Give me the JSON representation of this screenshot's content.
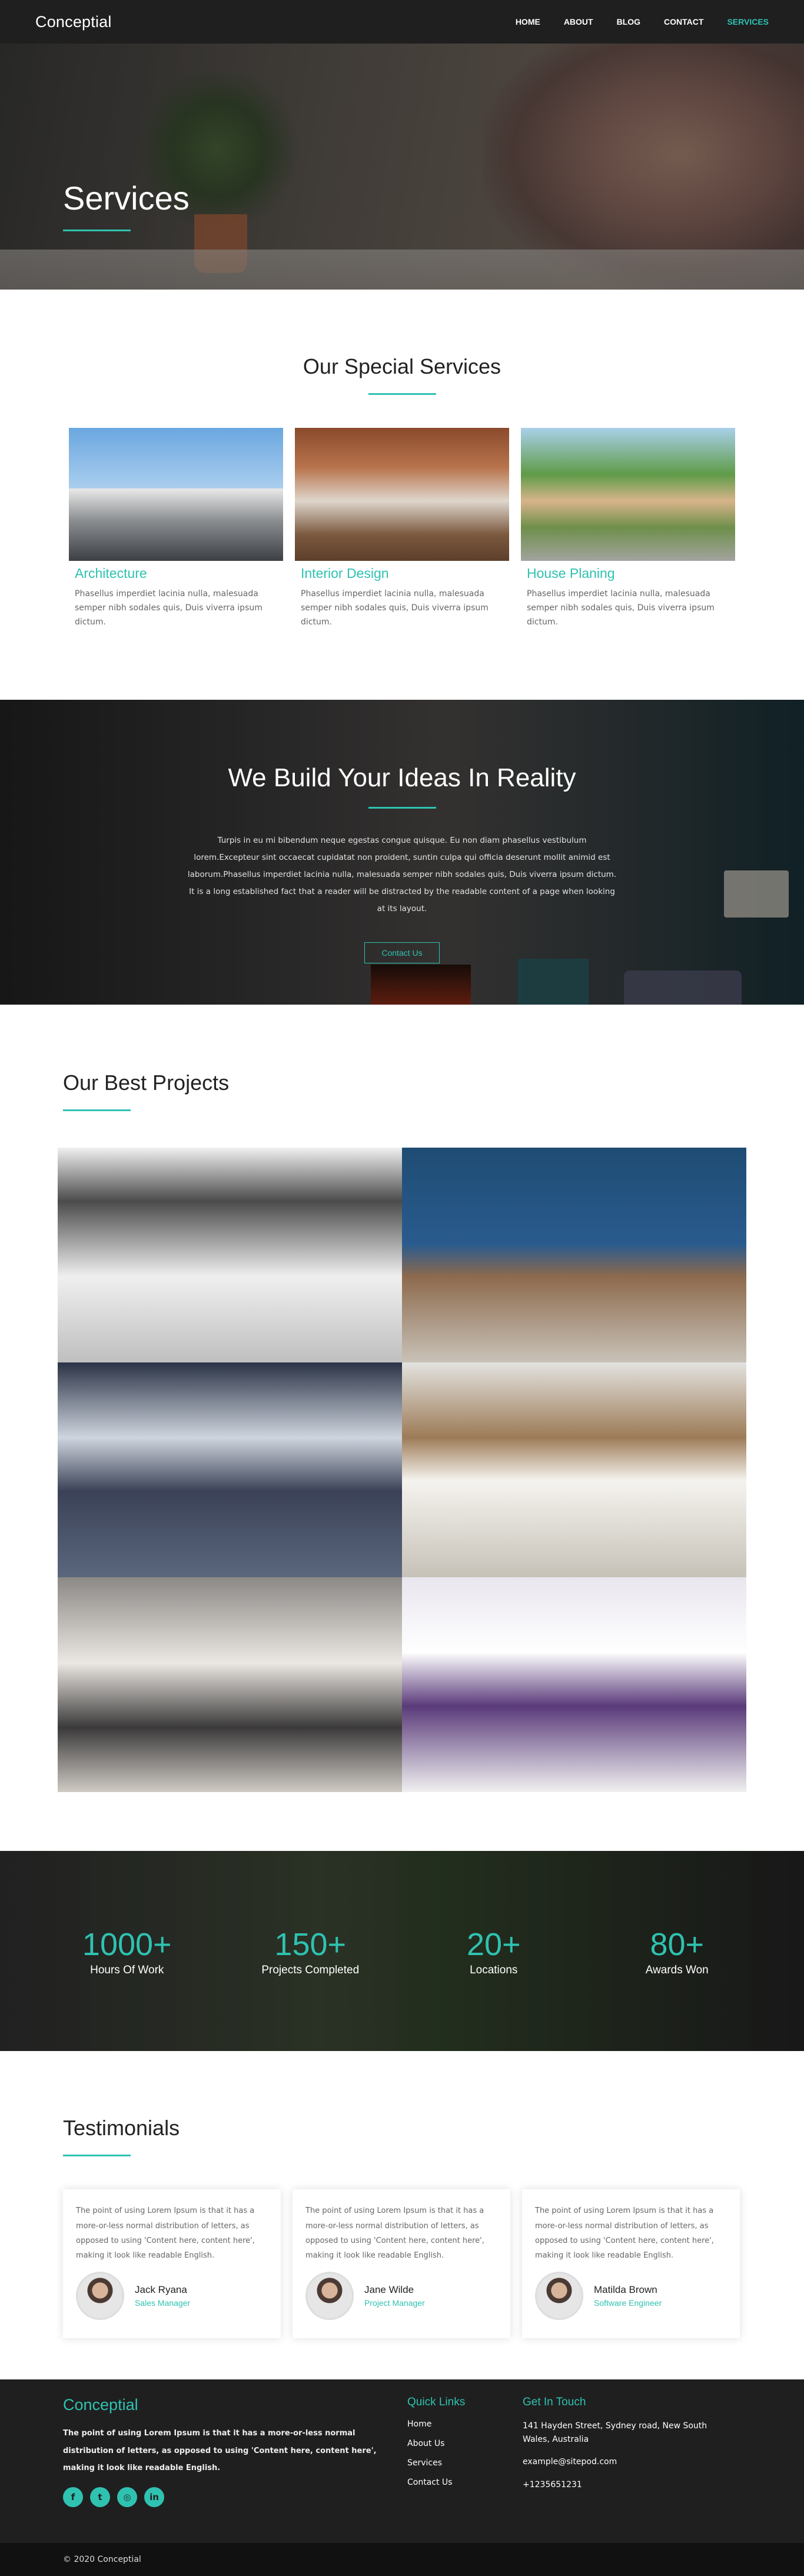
{
  "nav": {
    "logo": "Conceptial",
    "items": [
      {
        "label": "HOME",
        "active": false
      },
      {
        "label": "ABOUT",
        "active": false
      },
      {
        "label": "BLOG",
        "active": false
      },
      {
        "label": "CONTACT",
        "active": false
      },
      {
        "label": "SERVICES",
        "active": true
      }
    ]
  },
  "hero": {
    "title": "Services"
  },
  "services": {
    "title": "Our Special Services",
    "items": [
      {
        "title": "Architecture",
        "text": "Phasellus imperdiet lacinia nulla, malesuada semper nibh sodales quis, Duis viverra ipsum dictum."
      },
      {
        "title": "Interior Design",
        "text": "Phasellus imperdiet lacinia nulla, malesuada semper nibh sodales quis, Duis viverra ipsum dictum."
      },
      {
        "title": "House Planing",
        "text": "Phasellus imperdiet lacinia nulla, malesuada semper nibh sodales quis, Duis viverra ipsum dictum."
      }
    ]
  },
  "build": {
    "title": "We Build Your Ideas In Reality",
    "text": "Turpis in eu mi bibendum neque egestas congue quisque. Eu non diam phasellus vestibulum lorem.Excepteur sint occaecat cupidatat non proident, suntin culpa qui officia deserunt mollit animid est laborum.Phasellus imperdiet lacinia nulla, malesuada semper nibh sodales quis, Duis viverra ipsum dictum. It is a long established fact that a reader will be distracted by the readable content of a page when looking at its layout.",
    "button": "Contact Us"
  },
  "projects": {
    "title": "Our Best Projects"
  },
  "stats": [
    {
      "num": "1000+",
      "label": "Hours Of Work"
    },
    {
      "num": "150+",
      "label": "Projects Completed"
    },
    {
      "num": "20+",
      "label": "Locations"
    },
    {
      "num": "80+",
      "label": "Awards Won"
    }
  ],
  "testimonials": {
    "title": "Testimonials",
    "items": [
      {
        "text": "The point of using Lorem Ipsum is that it has a more-or-less normal distribution of letters, as opposed to using 'Content here, content here', making it look like readable English.",
        "name": "Jack Ryana",
        "role": "Sales Manager"
      },
      {
        "text": "The point of using Lorem Ipsum is that it has a more-or-less normal distribution of letters, as opposed to using 'Content here, content here', making it look like readable English.",
        "name": "Jane Wilde",
        "role": "Project Manager"
      },
      {
        "text": "The point of using Lorem Ipsum is that it has a more-or-less normal distribution of letters, as opposed to using 'Content here, content here', making it look like readable English.",
        "name": "Matilda Brown",
        "role": "Software Engineer"
      }
    ]
  },
  "footer": {
    "logo": "Conceptial",
    "about": "The point of using Lorem Ipsum is that it has a more-or-less normal distribution of letters, as opposed to using 'Content here, content here', making it look like readable English.",
    "socials": [
      {
        "icon": "facebook-icon",
        "glyph": "f"
      },
      {
        "icon": "twitter-icon",
        "glyph": "t"
      },
      {
        "icon": "instagram-icon",
        "glyph": "◎"
      },
      {
        "icon": "linkedin-icon",
        "glyph": "in"
      }
    ],
    "links_title": "Quick Links",
    "links": [
      "Home",
      "About Us",
      "Services",
      "Contact Us"
    ],
    "contact_title": "Get In Touch",
    "address": "141 Hayden Street, Sydney road, New South Wales, Australia",
    "email": "example@sitepod.com",
    "phone": "+1235651231",
    "copyright": "© 2020 Conceptial"
  },
  "colors": {
    "accent": "#2fc2b1",
    "dark": "#1f1f1f"
  }
}
